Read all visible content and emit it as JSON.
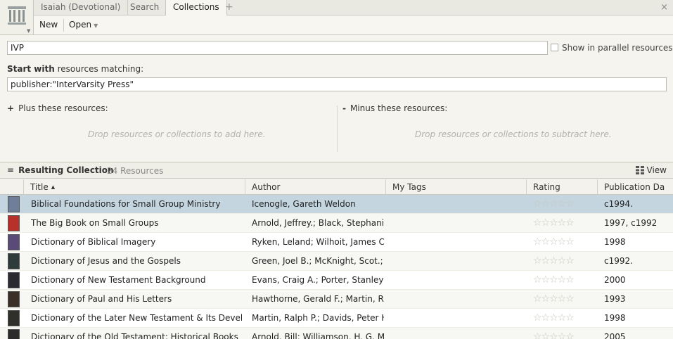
{
  "tabs": [
    {
      "label": "Isaiah (Devotional)"
    },
    {
      "label": "Search"
    },
    {
      "label": "Collections"
    }
  ],
  "tab_add": "+",
  "close": "×",
  "toolbar": {
    "new_label": "New",
    "open_label": "Open"
  },
  "collection": {
    "name": "IVP",
    "parallel_label": "Show in parallel resources",
    "start_bold": "Start with",
    "start_rest": " resources matching:",
    "query": "publisher:\"InterVarsity Press\"",
    "plus_label": "Plus these resources:",
    "minus_label": "Minus these resources:",
    "plus_hint": "Drop resources or collections to add here.",
    "minus_hint": "Drop resources or collections to subtract here."
  },
  "results": {
    "title": "Resulting Collection",
    "count": "24 Resources",
    "view_label": "View"
  },
  "columns": [
    "Title",
    "Author",
    "My Tags",
    "Rating",
    "Publication Da"
  ],
  "rows": [
    {
      "title": "Biblical Foundations for Small Group Ministry",
      "author": "Icenogle, Gareth Weldon",
      "tags": "",
      "rating": "☆☆☆☆☆",
      "date": "c1994.",
      "cover": "#6f7f9a"
    },
    {
      "title": "The Big Book on Small Groups",
      "author": "Arnold, Jeffrey.; Black, Stephanie.",
      "tags": "",
      "rating": "☆☆☆☆☆",
      "date": "1997, c1992",
      "cover": "#b8302a"
    },
    {
      "title": "Dictionary of Biblical Imagery",
      "author": "Ryken, Leland; Wilhoit, James C…",
      "tags": "",
      "rating": "☆☆☆☆☆",
      "date": "1998",
      "cover": "#5a4a78"
    },
    {
      "title": "Dictionary of Jesus and the Gospels",
      "author": "Green, Joel B.; McKnight, Scot.;…",
      "tags": "",
      "rating": "☆☆☆☆☆",
      "date": "c1992.",
      "cover": "#2f3a3a"
    },
    {
      "title": "Dictionary of New Testament Background",
      "author": "Evans, Craig A.; Porter, Stanley E.",
      "tags": "",
      "rating": "☆☆☆☆☆",
      "date": "2000",
      "cover": "#2a2a30"
    },
    {
      "title": "Dictionary of Paul and His Letters",
      "author": "Hawthorne, Gerald F.; Martin, R…",
      "tags": "",
      "rating": "☆☆☆☆☆",
      "date": "1993",
      "cover": "#3a3028"
    },
    {
      "title": "Dictionary of the Later New Testament & Its Develo…",
      "author": "Martin, Ralph P.; Davids, Peter H.",
      "tags": "",
      "rating": "☆☆☆☆☆",
      "date": "1998",
      "cover": "#30302a"
    },
    {
      "title": "Dictionary of the Old Testament: Historical Books",
      "author": "Arnold, Bill; Williamson, H. G. M.",
      "tags": "",
      "rating": "☆☆☆☆☆",
      "date": "2005",
      "cover": "#2c2c2c"
    }
  ]
}
